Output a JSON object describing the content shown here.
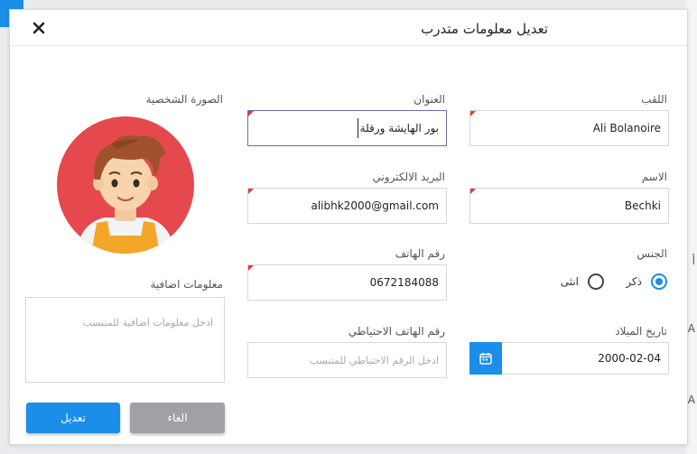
{
  "background": {
    "right_chars": [
      "أ",
      "A",
      "A"
    ]
  },
  "dialog": {
    "title": "تعديل معلومات متدرب",
    "close_icon": "close-icon"
  },
  "form": {
    "laqab": {
      "label": "اللقب",
      "value": "Ali Bolanoire"
    },
    "ism": {
      "label": "الاسم",
      "value": "Bechki"
    },
    "gender": {
      "label": "الجنس",
      "options": [
        {
          "label": "ذكر",
          "selected": true
        },
        {
          "label": "انثى",
          "selected": false
        }
      ]
    },
    "birth_date": {
      "label": "تاريخ الميلاد",
      "value": "2000-02-04",
      "icon": "calendar-icon"
    },
    "address": {
      "label": "العنوان",
      "value": "بور الهايشة ورقلة"
    },
    "email": {
      "label": "البريد الالكتروني",
      "value": "alibhk2000@gmail.com"
    },
    "phone": {
      "label": "رقم الهاتف",
      "value": "0672184088"
    },
    "backup_phone": {
      "label": "رقم الهاتف الاحتياطي",
      "placeholder": "ادخل الرقم الاحتياطي للمتنسب"
    },
    "photo": {
      "label": "الصورة الشخصية"
    },
    "extra": {
      "label": "معلومات اضافية",
      "placeholder": "ادخل معلومات اضافية للمتنسب"
    }
  },
  "buttons": {
    "cancel": "الغاء",
    "submit": "تعديل"
  },
  "colors": {
    "primary": "#1a8ee8",
    "cancel": "#9fa1a4",
    "required_marker": "#e03a3a",
    "avatar_bg": "#e5484d"
  }
}
